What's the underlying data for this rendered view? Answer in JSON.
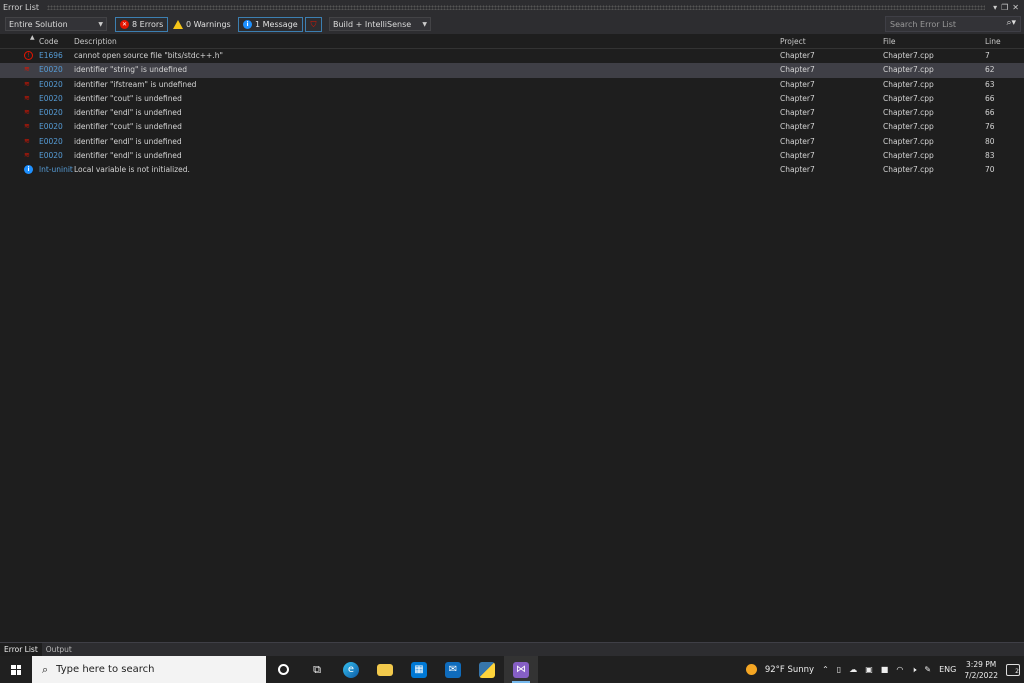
{
  "panel": {
    "title": "Error List"
  },
  "toolbar": {
    "scope": "Entire Solution",
    "errors_label": "8 Errors",
    "warnings_label": "0 Warnings",
    "messages_label": "1 Message",
    "source": "Build + IntelliSense",
    "search_placeholder": "Search Error List"
  },
  "columns": {
    "code": "Code",
    "description": "Description",
    "project": "Project",
    "file": "File",
    "line": "Line"
  },
  "rows": [
    {
      "type": "error",
      "code": "E1696",
      "description": "cannot open source file \"bits/stdc++.h\"",
      "project": "Chapter7",
      "file": "Chapter7.cpp",
      "line": "7"
    },
    {
      "type": "squiggle",
      "code": "E0020",
      "description": "identifier \"string\" is undefined",
      "project": "Chapter7",
      "file": "Chapter7.cpp",
      "line": "62"
    },
    {
      "type": "squiggle",
      "code": "E0020",
      "description": "identifier \"ifstream\" is undefined",
      "project": "Chapter7",
      "file": "Chapter7.cpp",
      "line": "63"
    },
    {
      "type": "squiggle",
      "code": "E0020",
      "description": "identifier \"cout\" is undefined",
      "project": "Chapter7",
      "file": "Chapter7.cpp",
      "line": "66"
    },
    {
      "type": "squiggle",
      "code": "E0020",
      "description": "identifier \"endl\" is undefined",
      "project": "Chapter7",
      "file": "Chapter7.cpp",
      "line": "66"
    },
    {
      "type": "squiggle",
      "code": "E0020",
      "description": "identifier \"cout\" is undefined",
      "project": "Chapter7",
      "file": "Chapter7.cpp",
      "line": "76"
    },
    {
      "type": "squiggle",
      "code": "E0020",
      "description": "identifier \"endl\" is undefined",
      "project": "Chapter7",
      "file": "Chapter7.cpp",
      "line": "80"
    },
    {
      "type": "squiggle",
      "code": "E0020",
      "description": "identifier \"endl\" is undefined",
      "project": "Chapter7",
      "file": "Chapter7.cpp",
      "line": "83"
    },
    {
      "type": "info",
      "code": "lnt-uninit",
      "description": "Local variable is not initialized.",
      "project": "Chapter7",
      "file": "Chapter7.cpp",
      "line": "70"
    }
  ],
  "bottom_tabs": [
    "Error List",
    "Output"
  ],
  "taskbar": {
    "search_placeholder": "Type here to search",
    "weather": "92°F  Sunny",
    "language": "ENG",
    "time": "3:29 PM",
    "date": "7/2/2022",
    "notification_count": "2"
  },
  "colors": {
    "accent": "#3c7fb1",
    "error": "#e51400",
    "info": "#1e90ff",
    "code_link": "#569cd6"
  }
}
